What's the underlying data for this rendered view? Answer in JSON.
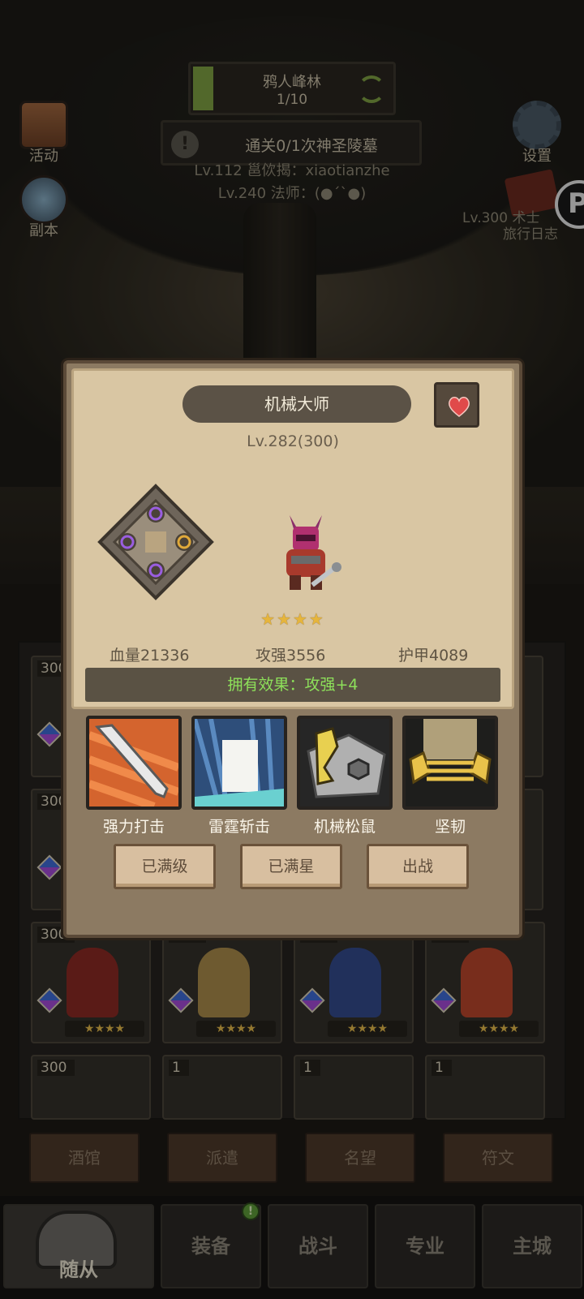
{
  "hud": {
    "stage_name": "鸦人峰林",
    "stage_progress": "1/10",
    "stage_progress_fraction": 0.1,
    "quest_text": "通关0/1次神圣陵墓",
    "chat_line_1": "Lv.112 邕佽揭：xiaotianzhe",
    "chat_line_2": "Lv.240 法师：(●´`●)",
    "event_label": "活动",
    "dungeon_label": "副本",
    "settings_label": "设置",
    "journal_line_1": "Lv.300 术士",
    "journal_line_2": "旅行日志",
    "bubble_letter": "P"
  },
  "modal": {
    "hero_name": "机械大师",
    "level": "Lv.282(300)",
    "stars": "★★★★",
    "stats": {
      "hp": "血量21336",
      "attack": "攻强3556",
      "armor": "护甲4089"
    },
    "owned_effect": "拥有效果：攻强+4",
    "skills": [
      {
        "name": "强力打击"
      },
      {
        "name": "雷霆斩击"
      },
      {
        "name": "机械松鼠"
      },
      {
        "name": "坚韧"
      }
    ],
    "buttons": {
      "max_level": "已满级",
      "max_star": "已满星",
      "deploy": "出战"
    }
  },
  "grid": {
    "cards": [
      {
        "level": "300",
        "stars": "★★★★"
      },
      {
        "level": "300",
        "stars": "★★★★"
      },
      {
        "level": "300",
        "stars": "★★★★"
      },
      {
        "level": "300",
        "stars": "★★★★"
      },
      {
        "level": "300",
        "stars": "★★★★"
      },
      {
        "level": "300",
        "stars": "★★★★"
      },
      {
        "level": "300",
        "stars": ""
      },
      {
        "level": "1",
        "stars": ""
      },
      {
        "level": "1",
        "stars": ""
      },
      {
        "level": "1",
        "stars": ""
      }
    ]
  },
  "sub_tabs": [
    "酒馆",
    "派遣",
    "名望",
    "符文"
  ],
  "main_tabs": {
    "active": "随从",
    "others": [
      "装备",
      "战斗",
      "专业",
      "主城"
    ],
    "notification": "!"
  },
  "colors": {
    "effect_text": "#8de05a",
    "star_gold": "#e6b53c",
    "progress_green": "#7ea042"
  }
}
